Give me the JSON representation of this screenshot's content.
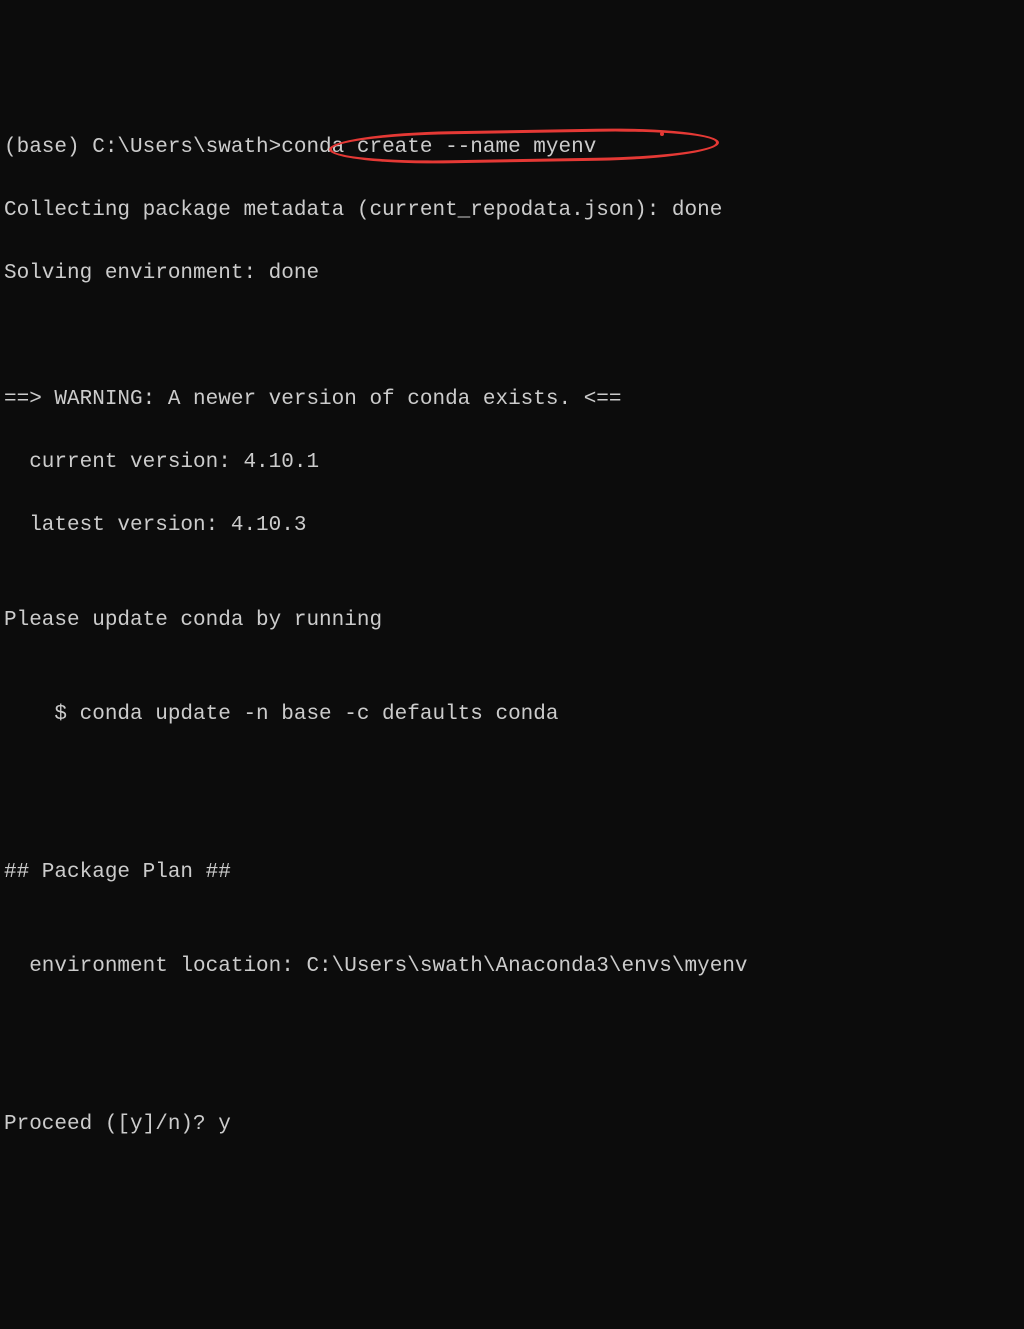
{
  "prompt": {
    "prefix": "(base) C:\\Users\\swath>",
    "command": "conda create --name myenv"
  },
  "output": {
    "line1": "Collecting package metadata (current_repodata.json): done",
    "line2": "Solving environment: done",
    "blank1": "",
    "blank2": "",
    "warning_header": "==> WARNING: A newer version of conda exists. <==",
    "current_version": "  current version: 4.10.1",
    "latest_version": "  latest version: 4.10.3",
    "blank3": "",
    "update_instruction": "Please update conda by running",
    "blank4": "",
    "update_command": "    $ conda update -n base -c defaults conda",
    "blank5": "",
    "blank6": "",
    "blank7": "",
    "package_plan_header": "## Package Plan ##",
    "blank8": "",
    "env_location": "  environment location: C:\\Users\\swath\\Anaconda3\\envs\\myenv",
    "blank9": "",
    "blank10": "",
    "blank11": "",
    "proceed_prompt": "Proceed ([y]/n)? y"
  }
}
